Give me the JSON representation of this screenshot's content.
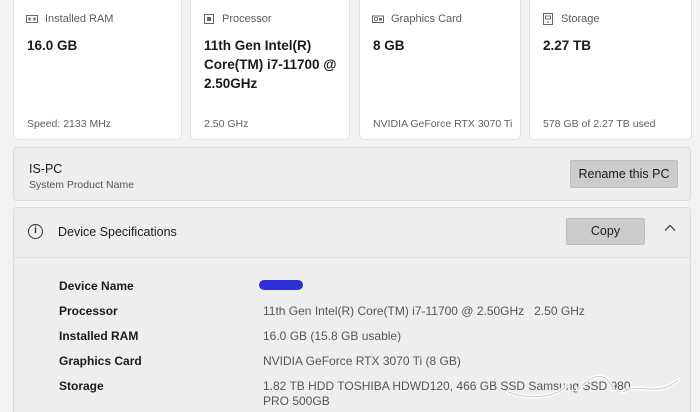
{
  "cards": [
    {
      "title": "Installed RAM",
      "value": "16.0 GB",
      "footer": "Speed: 2133 MHz",
      "icon": "ram-icon"
    },
    {
      "title": "Processor",
      "value": "11th Gen Intel(R) Core(TM) i7-11700 @ 2.50GHz",
      "footer": "2.50 GHz",
      "icon": "processor-icon"
    },
    {
      "title": "Graphics Card",
      "value": "8 GB",
      "footer": "NVIDIA GeForce RTX 3070 Ti",
      "icon": "graphics-card-icon"
    },
    {
      "title": "Storage",
      "value": "2.27 TB",
      "footer": "578 GB of 2.27 TB used",
      "icon": "storage-icon"
    }
  ],
  "pc": {
    "name": "IS-PC",
    "model": "System Product Name",
    "rename_label": "Rename this PC"
  },
  "specs": {
    "title": "Device Specifications",
    "copy_label": "Copy",
    "rows": [
      {
        "key": "Device Name",
        "value": ""
      },
      {
        "key": "Processor",
        "value": "11th Gen Intel(R) Core(TM) i7-11700 @ 2.50GHz   2.50 GHz"
      },
      {
        "key": "Installed RAM",
        "value": "16.0 GB (15.8 GB usable)"
      },
      {
        "key": "Graphics Card",
        "value": "NVIDIA GeForce RTX 3070 Ti (8 GB)"
      },
      {
        "key": "Storage",
        "value": "1.82 TB HDD TOSHIBA HDWD120, 466 GB SSD Samsung SSD 980 PRO 500GB"
      }
    ]
  },
  "colors": {
    "button_bg": "#cccccc",
    "redaction": "#2f2fd8"
  }
}
